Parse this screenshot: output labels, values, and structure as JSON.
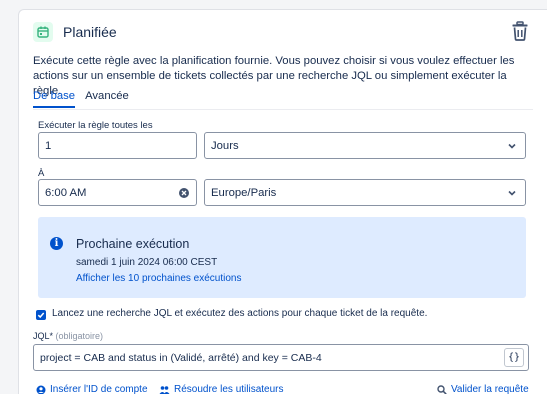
{
  "header": {
    "title": "Planifiée",
    "icon": "calendar-icon",
    "delete_icon": "trash-icon"
  },
  "description": "Exécute cette règle avec la planification fournie. Vous pouvez choisir si vous voulez effectuer les actions sur un ensemble de tickets collectés par une recherche JQL ou simplement exécuter la règle.",
  "tabs": [
    {
      "label": "De base",
      "active": true
    },
    {
      "label": "Avancée",
      "active": false
    }
  ],
  "schedule": {
    "every_label": "Exécuter la règle toutes les",
    "interval_value": "1",
    "unit_value": "Jours",
    "at_label": "À",
    "time_value": "6:00 AM",
    "timezone_value": "Europe/Paris"
  },
  "next_run": {
    "title": "Prochaine exécution",
    "date": "samedi 1 juin 2024 06:00 CEST",
    "link": "Afficher les 10 prochaines exécutions"
  },
  "jql": {
    "checkbox_label": "Lancez une recherche JQL et exécutez des actions pour chaque ticket de la requête.",
    "checked": true,
    "label": "JQL*",
    "optional": "(obligatoire)",
    "value": "project = CAB  and status in (Validé, arrêté) and key = CAB-4",
    "braces": "{}"
  },
  "actions": {
    "insert_account": "Insérer l'ID de compte",
    "resolve_users": "Résoudre les utilisateurs",
    "validate_query": "Valider la requête"
  },
  "colors": {
    "accent": "#0052cc",
    "info_bg": "#deebff",
    "icon_green": "#36b37e"
  }
}
